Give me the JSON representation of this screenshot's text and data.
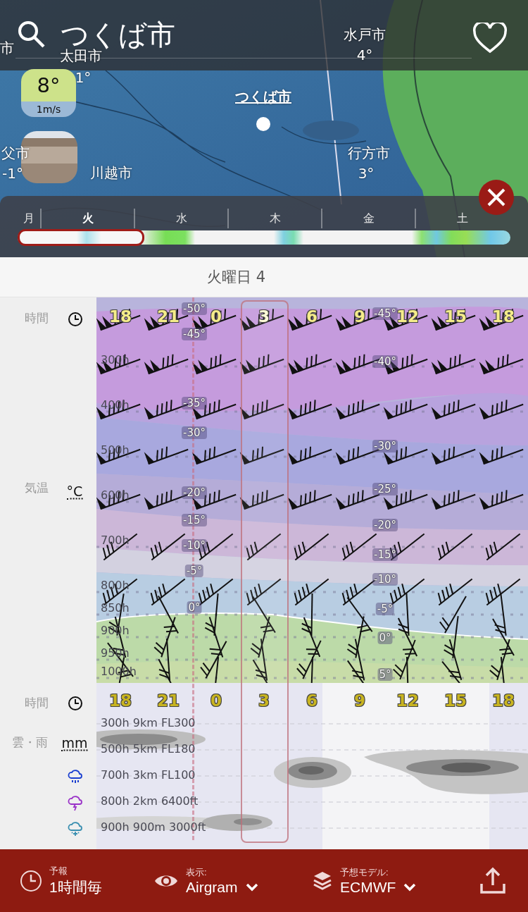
{
  "header": {
    "title": "つくば市",
    "favorite": false
  },
  "map": {
    "labels": [
      {
        "text": "市"
      },
      {
        "text": "太田市"
      },
      {
        "text": "1°"
      },
      {
        "text": "水戸市"
      },
      {
        "text": "4°"
      },
      {
        "text": "父市"
      },
      {
        "text": "-1°"
      },
      {
        "text": "川越市"
      },
      {
        "text": "行方市"
      },
      {
        "text": "3°"
      }
    ],
    "location": "つくば市"
  },
  "current": {
    "temp": "8°",
    "wind": "1m/s"
  },
  "timeline": {
    "days": [
      {
        "label": "月",
        "selected": false
      },
      {
        "label": "火",
        "selected": true
      },
      {
        "label": "水",
        "selected": false
      },
      {
        "label": "木",
        "selected": false
      },
      {
        "label": "金",
        "selected": false
      },
      {
        "label": "土",
        "selected": false
      }
    ]
  },
  "date_label": "火曜日 4",
  "airgram": {
    "time_label": "時間",
    "temp_label": "気温",
    "temp_unit": "°C",
    "times": [
      {
        "label": "18",
        "selected": false
      },
      {
        "label": "21",
        "selected": false
      },
      {
        "label": "0",
        "selected": false
      },
      {
        "label": "3",
        "selected": true
      },
      {
        "label": "6",
        "selected": false
      },
      {
        "label": "9",
        "selected": false
      },
      {
        "label": "12",
        "selected": false
      },
      {
        "label": "15",
        "selected": false
      },
      {
        "label": "18",
        "selected": false
      }
    ],
    "levels": [
      "300h",
      "400h",
      "500h",
      "600h",
      "700h",
      "800h",
      "850h",
      "900h",
      "950h",
      "1000h"
    ],
    "isotherms_left": [
      "-50°",
      "-45°",
      "-35°",
      "-30°",
      "-20°",
      "-15°",
      "-10°",
      "-5°",
      "0°"
    ],
    "isotherms_right": [
      "-45°",
      "-40°",
      "-30°",
      "-25°",
      "-20°",
      "-15°",
      "-10°",
      "-5°",
      "0°",
      "5°"
    ]
  },
  "clouds": {
    "time_label": "時間",
    "label": "雲・雨",
    "unit": "mm",
    "times": [
      "18",
      "21",
      "0",
      "3",
      "6",
      "9",
      "12",
      "15",
      "18"
    ],
    "levels": [
      "300h 9km FL300",
      "500h 5km FL180",
      "700h 3km FL100",
      "800h 2km 6400ft",
      "900h 900m 3000ft"
    ]
  },
  "bottom_bar": {
    "items": [
      {
        "kind": "forecast",
        "label": "予報",
        "value": "1時間毎",
        "dropdown": false
      },
      {
        "kind": "view",
        "label": "表示:",
        "value": "Airgram",
        "dropdown": true
      },
      {
        "kind": "model",
        "label": "予想モデル:",
        "value": "ECMWF",
        "dropdown": true
      }
    ]
  }
}
